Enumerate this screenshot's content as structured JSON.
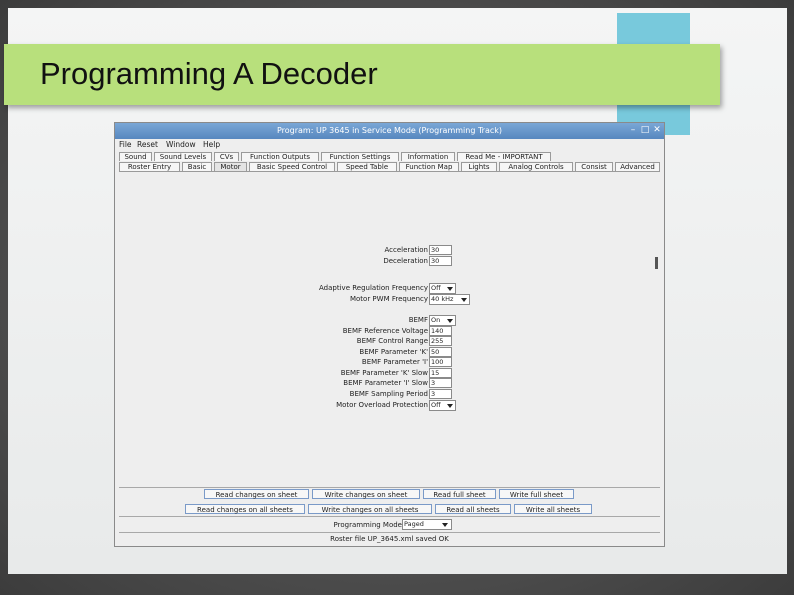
{
  "slide": {
    "title": "Programming A Decoder"
  },
  "window": {
    "title": "Program: UP 3645 in Service Mode (Programming Track)",
    "controls": {
      "minimize": "–",
      "maximize": "□",
      "close": "✕"
    }
  },
  "menu": [
    "File",
    "Reset",
    "Window",
    "Help"
  ],
  "tabs_row1": [
    {
      "label": "Sound"
    },
    {
      "label": "Sound Levels"
    },
    {
      "label": "CVs"
    },
    {
      "label": "Function Outputs"
    },
    {
      "label": "Function Settings"
    },
    {
      "label": "Information"
    },
    {
      "label": "Read Me - IMPORTANT"
    }
  ],
  "tabs_row2": [
    {
      "label": "Roster Entry"
    },
    {
      "label": "Basic"
    },
    {
      "label": "Motor",
      "selected": true
    },
    {
      "label": "Basic Speed Control"
    },
    {
      "label": "Speed Table"
    },
    {
      "label": "Function Map"
    },
    {
      "label": "Lights"
    },
    {
      "label": "Analog Controls"
    },
    {
      "label": "Consist"
    },
    {
      "label": "Advanced"
    }
  ],
  "fields": {
    "acceleration": {
      "label": "Acceleration",
      "value": "30"
    },
    "deceleration": {
      "label": "Deceleration",
      "value": "30"
    },
    "adaptive_regulation_frequency": {
      "label": "Adaptive Regulation Frequency",
      "value": "Off"
    },
    "motor_pwm_frequency": {
      "label": "Motor PWM Frequency",
      "value": "40 kHz"
    },
    "bemf": {
      "label": "BEMF",
      "value": "On"
    },
    "bemf_reference_voltage": {
      "label": "BEMF Reference Voltage",
      "value": "140"
    },
    "bemf_control_range": {
      "label": "BEMF Control Range",
      "value": "255"
    },
    "bemf_parameter_k": {
      "label": "BEMF Parameter 'K'",
      "value": "50"
    },
    "bemf_parameter_i": {
      "label": "BEMF Parameter 'I'",
      "value": "100"
    },
    "bemf_parameter_k_slow": {
      "label": "BEMF Parameter 'K' Slow",
      "value": "15"
    },
    "bemf_parameter_i_slow": {
      "label": "BEMF Parameter 'I' Slow",
      "value": "3"
    },
    "bemf_sampling_period": {
      "label": "BEMF Sampling Period",
      "value": "3"
    },
    "motor_overload_protection": {
      "label": "Motor Overload Protection",
      "value": "Off"
    }
  },
  "buttons": {
    "read_changes_sheet": "Read changes on sheet",
    "write_changes_sheet": "Write changes on sheet",
    "read_full_sheet": "Read full sheet",
    "write_full_sheet": "Write full sheet",
    "read_changes_all": "Read changes on all sheets",
    "write_changes_all": "Write changes on all sheets",
    "read_all": "Read all sheets",
    "write_all": "Write all sheets"
  },
  "programming_mode": {
    "label": "Programming Mode",
    "value": "Paged"
  },
  "status": "Roster file UP_3645.xml saved OK"
}
